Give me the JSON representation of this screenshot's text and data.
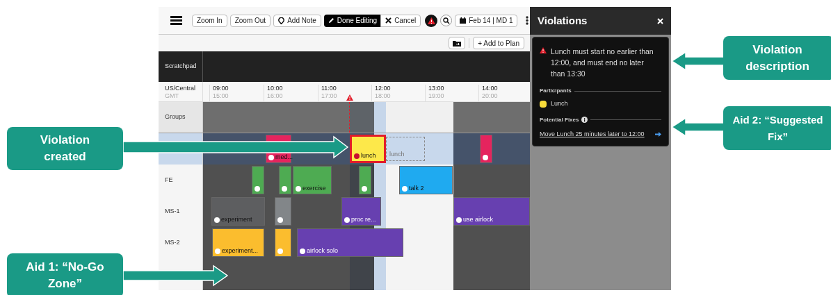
{
  "toolbar": {
    "buttons": [
      {
        "label": "Zoom In",
        "kind": "plain"
      },
      {
        "label": "Zoom Out",
        "kind": "plain"
      },
      {
        "label": "Add Note",
        "kind": "note"
      },
      {
        "label": "Done Editing",
        "kind": "primary"
      },
      {
        "label": "Cancel",
        "kind": "cancel"
      }
    ],
    "date": "Feb 14 | MD 1"
  },
  "secondary_toolbar": {
    "add_button": "+ Add to Plan"
  },
  "scratchpad": {
    "label": "Scratchpad"
  },
  "timezones": {
    "primary": "US/Central",
    "secondary": "GMT"
  },
  "hours": [
    {
      "local": "09:00",
      "gmt": "15:00"
    },
    {
      "local": "10:00",
      "gmt": "16:00"
    },
    {
      "local": "11:00",
      "gmt": "17:00"
    },
    {
      "local": "12:00",
      "gmt": "18:00"
    },
    {
      "local": "13:00",
      "gmt": "19:00"
    },
    {
      "local": "14:00",
      "gmt": "20:00"
    }
  ],
  "rows": [
    {
      "label": "Groups",
      "kind": "groups",
      "selected": false,
      "events": []
    },
    {
      "kind": "crew",
      "selected": true,
      "events": [
        {
          "label": "med...",
          "color": "#e5245e",
          "kind": "normal"
        },
        {
          "label": "lunch",
          "color": "#fde84a",
          "kind": "violating"
        },
        {
          "label": "lunch",
          "kind": "ghost"
        },
        {
          "color": "#e5245e",
          "kind": "normal"
        }
      ]
    },
    {
      "label": "FE",
      "kind": "crew",
      "selected": false,
      "events": [
        {
          "color": "#4eab52",
          "kind": "normal"
        },
        {
          "color": "#4eab52",
          "kind": "normal"
        },
        {
          "label": "exercise",
          "color": "#4eab52",
          "kind": "normal"
        },
        {
          "color": "#4eab52",
          "kind": "normal"
        },
        {
          "label": "talk 2",
          "color": "#1faaf0",
          "kind": "normal"
        }
      ]
    },
    {
      "label": "MS-1",
      "kind": "crew",
      "selected": false,
      "events": [
        {
          "label": "experiment",
          "color": "#5d5e60",
          "kind": "normal"
        },
        {
          "color": "#828689",
          "kind": "normal"
        },
        {
          "label": "proc re...",
          "color": "#6740b0",
          "kind": "normal"
        },
        {
          "label": "use airlock",
          "color": "#6740b0",
          "kind": "normal"
        }
      ]
    },
    {
      "label": "MS-2",
      "kind": "crew",
      "selected": false,
      "events": [
        {
          "label": "experiment...",
          "color": "#fbbd2e",
          "kind": "normal"
        },
        {
          "color": "#fbbd2e",
          "kind": "normal"
        },
        {
          "label": "airlock solo",
          "color": "#6740b0",
          "kind": "normal"
        }
      ]
    },
    {
      "kind": "crew",
      "selected": false,
      "events": []
    }
  ],
  "violations_panel": {
    "title": "Violations",
    "message": "Lunch must start no earlier than 12:00, and must end no later than 13:30",
    "participants_heading": "Participants",
    "participants": [
      {
        "label": "Lunch",
        "color": "#f7dc3a"
      }
    ],
    "fixes_heading": "Potential Fixes",
    "fixes": [
      "Move Lunch 25 minutes later to 12:00"
    ]
  },
  "callouts": [
    {
      "text": "Violation created"
    },
    {
      "text": "Aid 1: “No-Go Zone”"
    },
    {
      "text": "Violation description"
    },
    {
      "text": "Aid 2: “Suggested Fix”"
    }
  ]
}
